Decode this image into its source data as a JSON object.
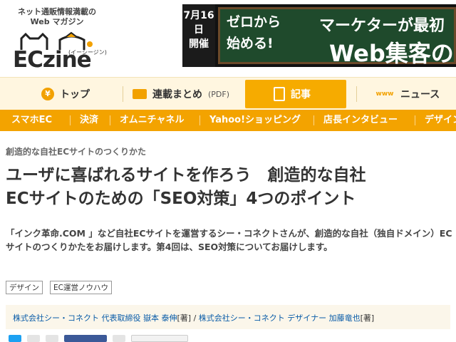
{
  "header": {
    "tagline": "ネット通販情報満載の Web マガジン",
    "brand": "ECzine",
    "brand_sub": "(イーシージン)",
    "banner": {
      "date": "7月16日",
      "date_suffix": "開催",
      "line1": "ゼロから",
      "line2": "始める!",
      "right1": "マーケターが最初",
      "right2": "Web集客の"
    }
  },
  "nav": {
    "items": [
      {
        "label": "トップ",
        "icon": "coin-icon"
      },
      {
        "label": "連載まとめ",
        "suffix": "(PDF)",
        "icon": "book-icon"
      },
      {
        "label": "記事",
        "icon": "document-icon",
        "active": true
      },
      {
        "label": "ニュース",
        "icon": "www-icon",
        "icon_text": "www"
      }
    ]
  },
  "categories": [
    "スマホEC",
    "決済",
    "オムニチャネル",
    "Yahoo!ショッピング",
    "店長インタビュー",
    "デザイン"
  ],
  "article": {
    "series": "創造的な自社ECサイトのつくりかた",
    "title_line1": "ユーザに喜ばれるサイトを作ろう　創造的な自社",
    "title_line2": "ECサイトのための「SEO対策」4つのポイント",
    "lead": "「インク革命.COM 」など自社ECサイトを運営するシー・コネクトさんが、創造的な自社（独自ドメイン）ECサイトのつくりかたをお届けします。第4回は、SEO対策についてお届けします。",
    "tags": [
      "デザイン",
      "EC運営ノウハウ"
    ],
    "authors": {
      "a1": "株式会社シー・コネクト 代表取締役 嶽本 泰伸",
      "a1_role": "[著]",
      "sep": " / ",
      "a2": "株式会社シー・コネクト デザイナー 加藤竜也",
      "a2_role": "[著]"
    }
  },
  "colors": {
    "accent": "#f6ab00",
    "nav_bg": "#fff6e0",
    "link": "#0a5ca8"
  }
}
